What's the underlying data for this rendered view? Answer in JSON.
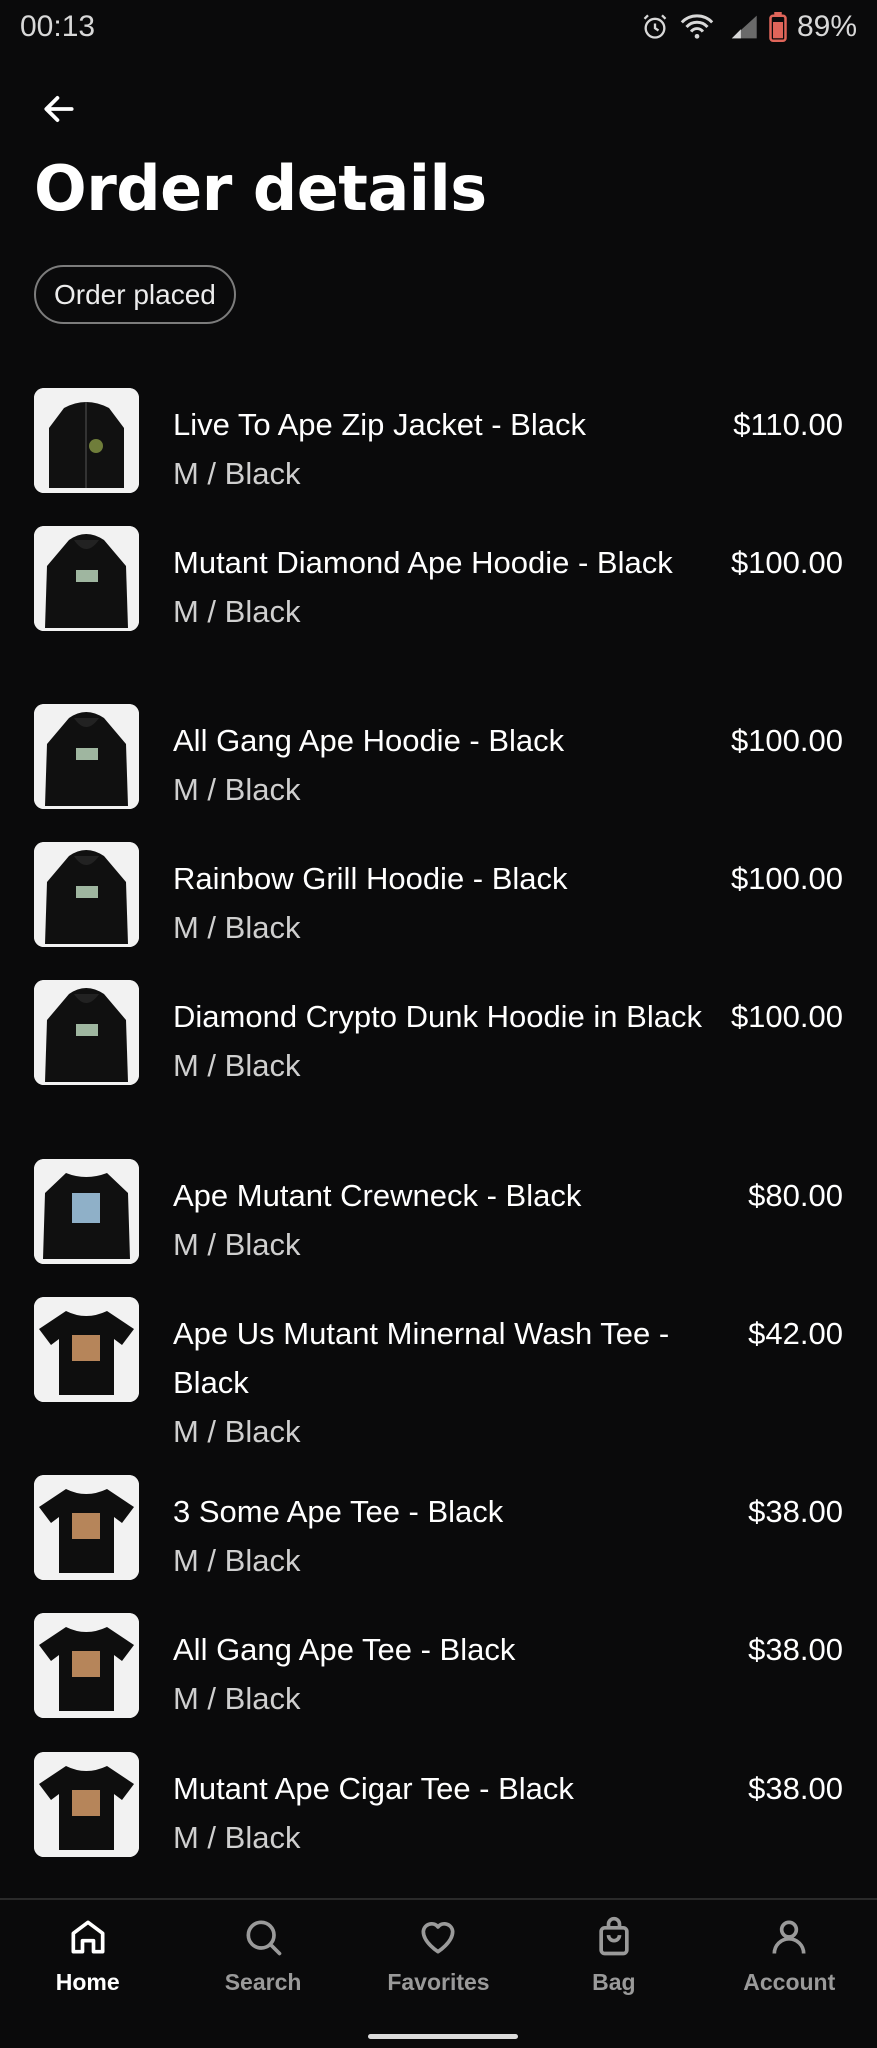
{
  "status_bar": {
    "time": "00:13",
    "battery": "89%",
    "icons": [
      "alarm-icon",
      "wifi-icon",
      "signal-icon",
      "battery-icon"
    ]
  },
  "header": {
    "back_icon": "arrow-left-icon",
    "title": "Order details",
    "status": "Order placed"
  },
  "items": [
    {
      "name": "Live To Ape Zip Jacket - Black",
      "variant": "M / Black",
      "price": "$110.00",
      "thumb": "jacket"
    },
    {
      "name": "Mutant Diamond Ape Hoodie - Black",
      "variant": "M / Black",
      "price": "$100.00",
      "thumb": "hoodie"
    },
    {
      "name": "All Gang Ape Hoodie - Black",
      "variant": "M / Black",
      "price": "$100.00",
      "thumb": "hoodie"
    },
    {
      "name": "Rainbow Grill Hoodie - Black",
      "variant": "M / Black",
      "price": "$100.00",
      "thumb": "hoodie"
    },
    {
      "name": "Diamond Crypto Dunk Hoodie in Black",
      "variant": "M / Black",
      "price": "$100.00",
      "thumb": "hoodie"
    },
    {
      "name": "Ape Mutant Crewneck - Black",
      "variant": "M / Black",
      "price": "$80.00",
      "thumb": "crewneck"
    },
    {
      "name": "Ape Us Mutant Minernal Wash Tee - Black",
      "variant": "M / Black",
      "price": "$42.00",
      "thumb": "tee"
    },
    {
      "name": "3 Some Ape Tee - Black",
      "variant": "M / Black",
      "price": "$38.00",
      "thumb": "tee"
    },
    {
      "name": "All Gang Ape Tee - Black",
      "variant": "M / Black",
      "price": "$38.00",
      "thumb": "tee"
    },
    {
      "name": "Mutant Ape Cigar Tee - Black",
      "variant": "M / Black",
      "price": "$38.00",
      "thumb": "tee"
    }
  ],
  "nav": [
    {
      "label": "Home",
      "icon": "home-icon",
      "active": true
    },
    {
      "label": "Search",
      "icon": "search-icon",
      "active": false
    },
    {
      "label": "Favorites",
      "icon": "heart-icon",
      "active": false
    },
    {
      "label": "Bag",
      "icon": "bag-icon",
      "active": false
    },
    {
      "label": "Account",
      "icon": "person-icon",
      "active": false
    }
  ]
}
